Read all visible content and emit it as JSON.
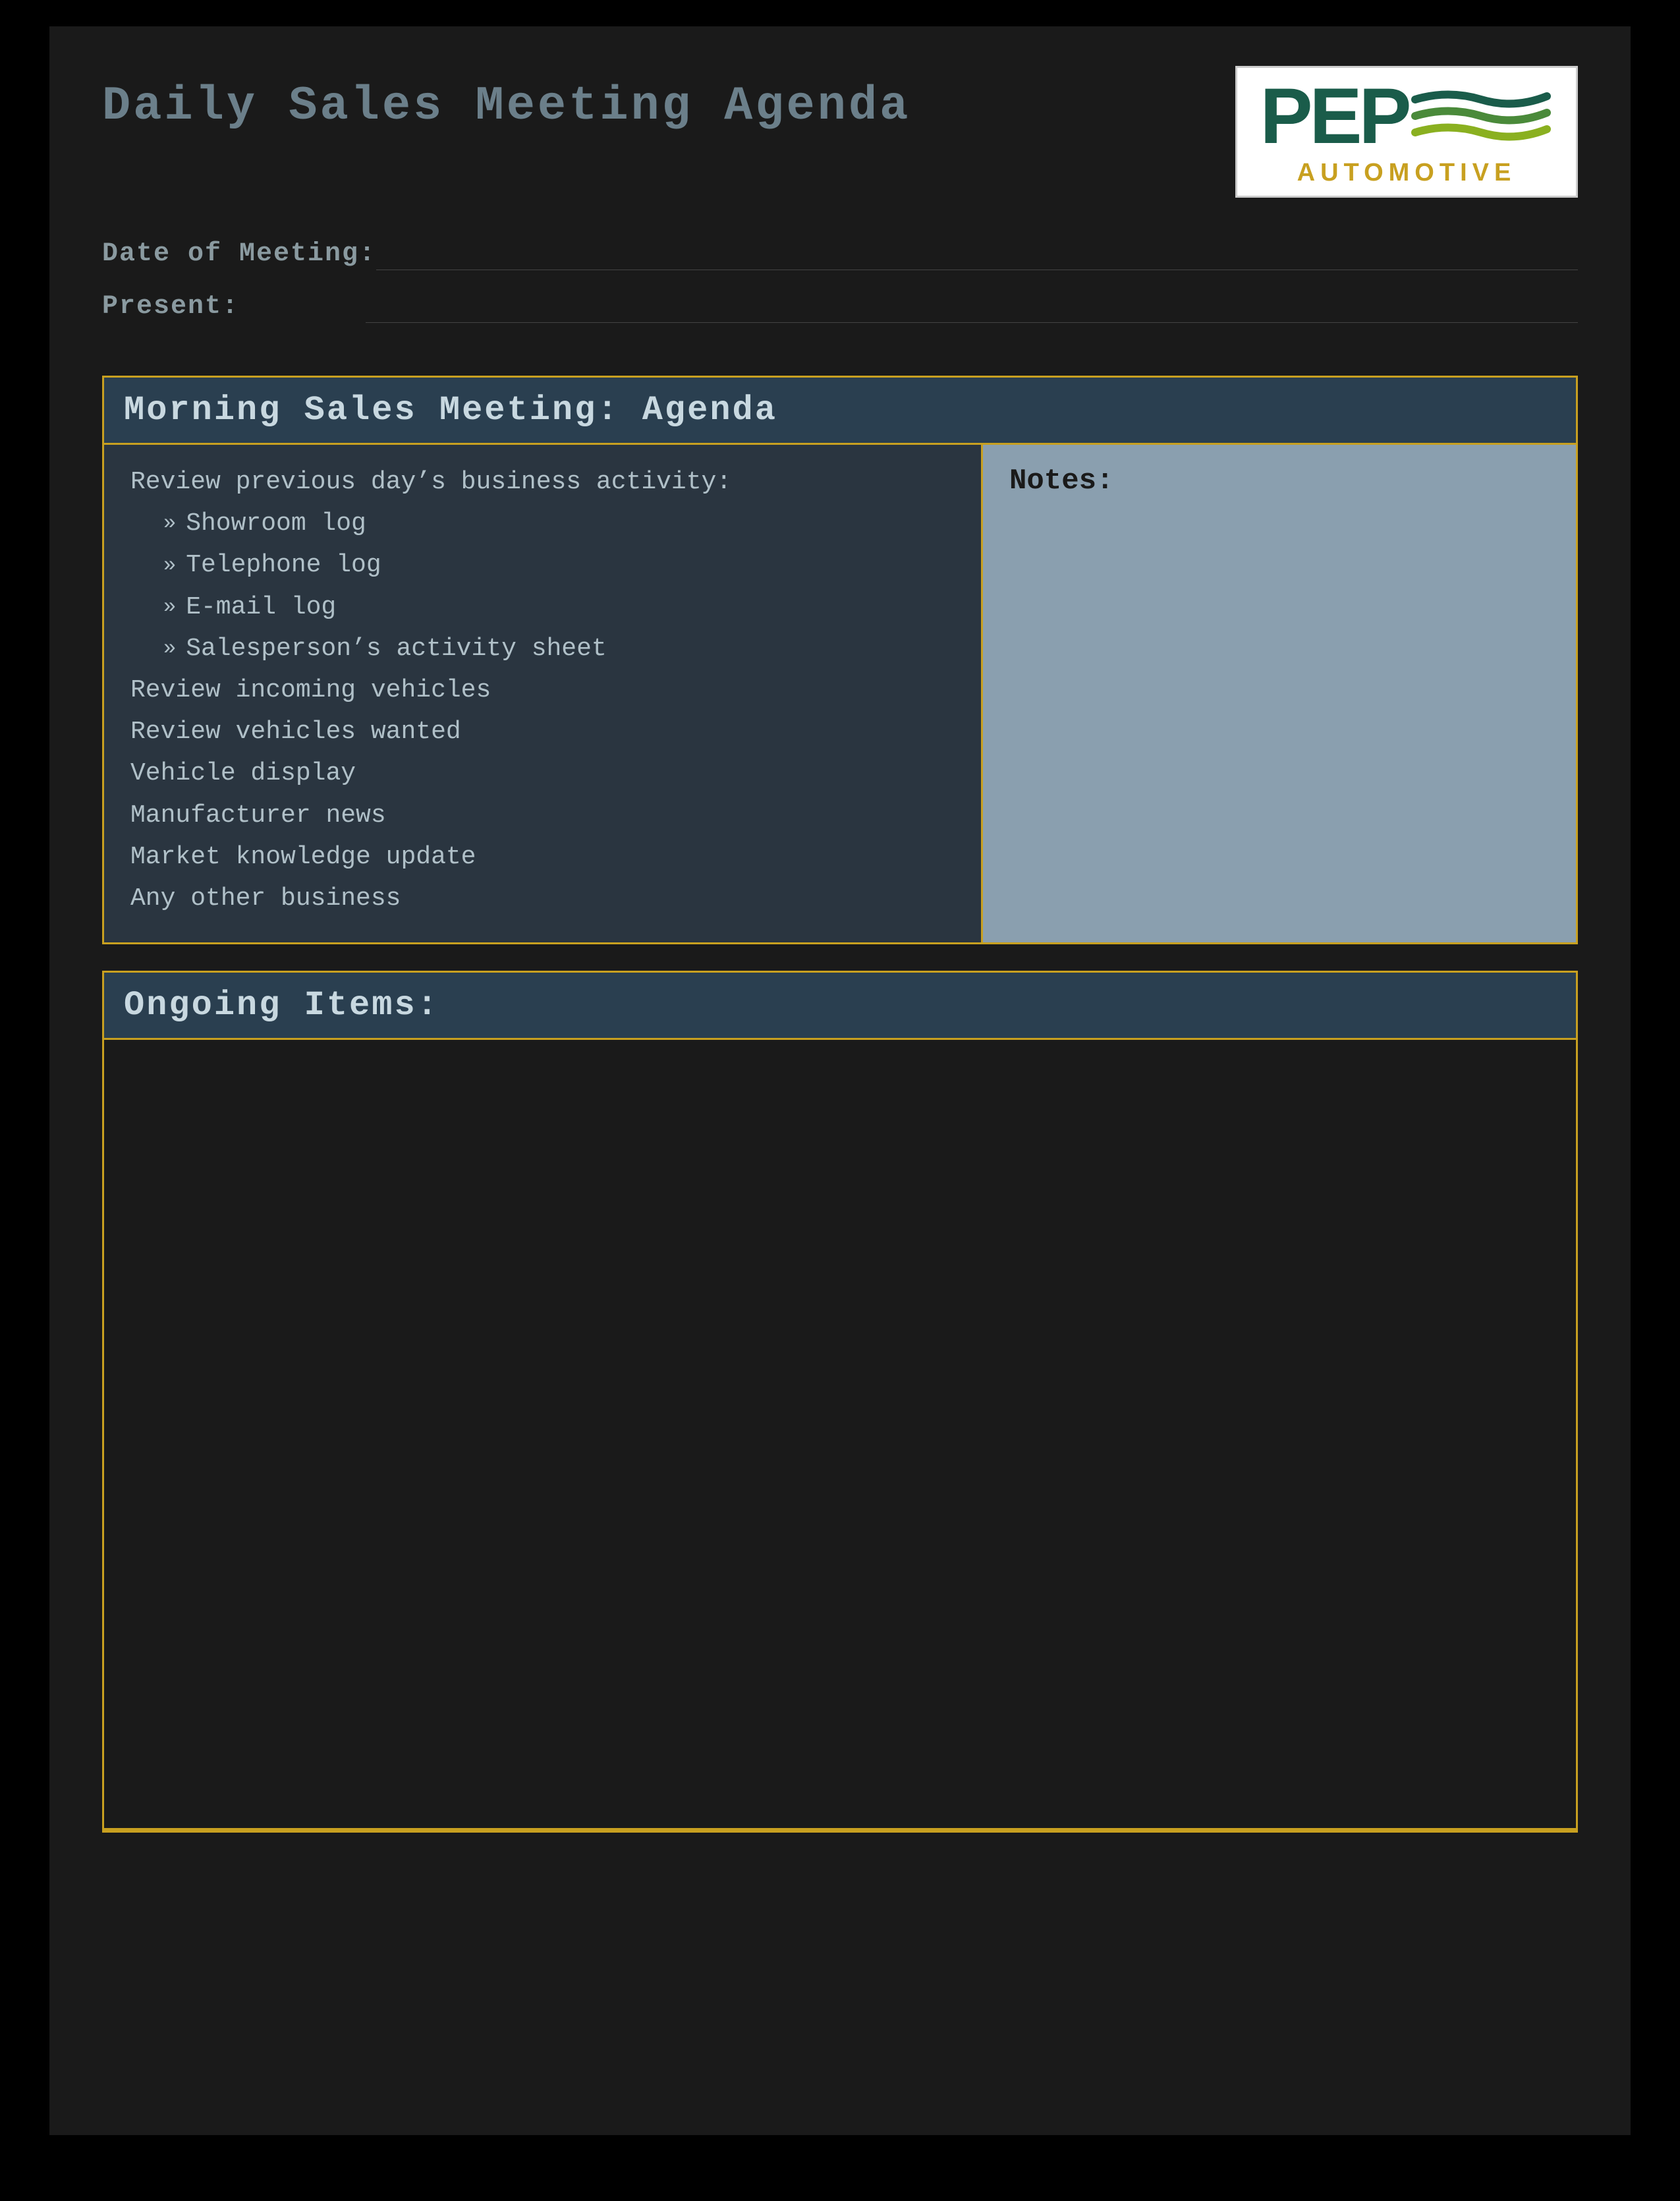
{
  "page": {
    "title": "Daily Sales Meeting Agenda",
    "background_color": "#1a1a1a"
  },
  "logo": {
    "pep_text": "PEP",
    "automotive_text": "AUTOMOTIVE",
    "brand_color": "#1a5c4a",
    "accent_color": "#c8a020"
  },
  "fields": {
    "date_label": "Date of Meeting:",
    "date_value": "",
    "present_label": "Present:",
    "present_value": ""
  },
  "morning_section": {
    "title": "Morning Sales Meeting: Agenda",
    "agenda_items": [
      {
        "text": "Review previous day’s business activity:",
        "sub": false
      },
      {
        "text": "Showroom log",
        "sub": true
      },
      {
        "text": "Telephone log",
        "sub": true
      },
      {
        "text": "E-mail log",
        "sub": true
      },
      {
        "text": "Salesperson’s activity sheet",
        "sub": true
      },
      {
        "text": "Review incoming vehicles",
        "sub": false
      },
      {
        "text": "Review vehicles wanted",
        "sub": false
      },
      {
        "text": "Vehicle display",
        "sub": false
      },
      {
        "text": "Manufacturer news",
        "sub": false
      },
      {
        "text": "Market knowledge update",
        "sub": false
      },
      {
        "text": "Any other business",
        "sub": false
      }
    ],
    "notes_label": "Notes:"
  },
  "ongoing_section": {
    "title": "Ongoing Items:"
  }
}
